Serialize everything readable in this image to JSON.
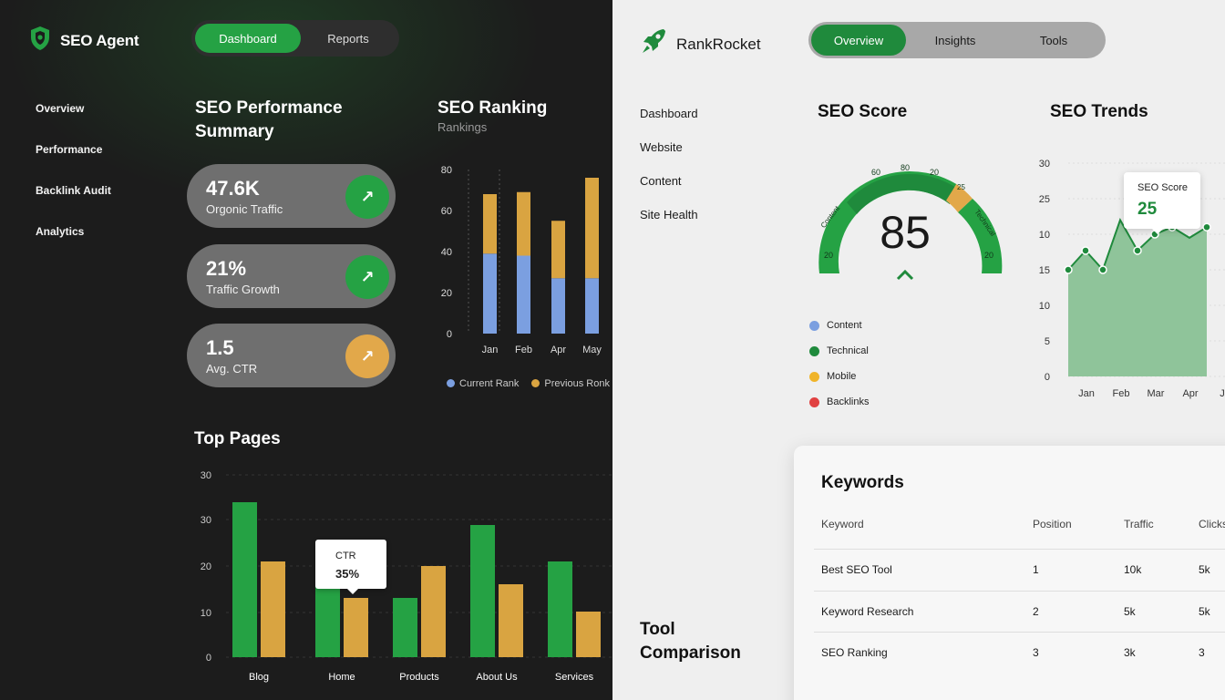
{
  "left": {
    "brand": "SEO Agent",
    "tabs": [
      "Dashboard",
      "Reports"
    ],
    "nav": [
      "Overview",
      "Performance",
      "Backlink Audit",
      "Analytics"
    ],
    "summary_title": "SEO Performance Summary",
    "kpis": [
      {
        "value": "47.6K",
        "label": "Orgonic Traffic",
        "color": "#25a244"
      },
      {
        "value": "21%",
        "label": "Traffic Growth",
        "color": "#25a244"
      },
      {
        "value": "1.5",
        "label": "Avg. CTR",
        "color": "#e2a84a"
      }
    ],
    "ranking_title": "SEO Ranking",
    "ranking_subtitle": "Rankings",
    "ranking_legend": [
      "Current Rank",
      "Previous Ronk"
    ],
    "top_pages_title": "Top Pages",
    "tooltip": {
      "label": "CTR",
      "value": "35%"
    }
  },
  "right": {
    "brand": "RankRocket",
    "tabs": [
      "Overview",
      "Insights",
      "Tools"
    ],
    "nav": [
      "Dashboard",
      "Website",
      "Content",
      "Site Health"
    ],
    "score_title": "SEO Score",
    "score_value": "85",
    "gauge_labels": [
      "20",
      "Content",
      "60",
      "80",
      "20",
      "25",
      "Technical",
      "20"
    ],
    "legend": [
      {
        "label": "Content",
        "color": "#7b9fe0"
      },
      {
        "label": "Technical",
        "color": "#1f8a3c"
      },
      {
        "label": "Mobile",
        "color": "#f0b429"
      },
      {
        "label": "Backlinks",
        "color": "#e04040"
      }
    ],
    "trends_title": "SEO Trends",
    "trend_tooltip": {
      "label": "SEO Score",
      "value": "25"
    },
    "tool_title": "Tool Comparison",
    "keywords": {
      "title": "Keywords",
      "headers": [
        "Keyword",
        "Position",
        "Traffic",
        "Clicks"
      ],
      "rows": [
        [
          "Best SEO Tool",
          "1",
          "10k",
          "5k"
        ],
        [
          "Keyword Research",
          "2",
          "5k",
          "5k"
        ],
        [
          "SEO Ranking",
          "3",
          "3k",
          "3"
        ]
      ]
    }
  },
  "chart_data": [
    {
      "type": "bar",
      "title": "SEO Ranking",
      "subtitle": "Rankings",
      "stacked": true,
      "categories": [
        "Jan",
        "Feb",
        "Apr",
        "May"
      ],
      "series": [
        {
          "name": "Current Rank",
          "values": [
            39,
            38,
            27,
            27
          ],
          "color": "#7b9fe0"
        },
        {
          "name": "Previous Ronk",
          "values": [
            29,
            31,
            28,
            49
          ],
          "color": "#d9a441"
        }
      ],
      "yticks": [
        0,
        20,
        40,
        60,
        80
      ],
      "ylim": [
        0,
        80
      ]
    },
    {
      "type": "bar",
      "title": "Top Pages",
      "categories": [
        "Blog",
        "Home",
        "Products",
        "About Us",
        "Services"
      ],
      "series": [
        {
          "values": [
            34,
            25,
            13,
            29,
            21
          ],
          "color": "#25a244"
        },
        {
          "values": [
            21,
            13,
            20,
            16,
            10
          ],
          "color": "#d9a441"
        }
      ],
      "yticks": [
        "0",
        "10",
        "20",
        "30",
        "30"
      ],
      "ylim": [
        0,
        40
      ]
    },
    {
      "type": "area",
      "title": "SEO Trends",
      "categories": [
        "Jan",
        "Feb",
        "Mar",
        "Apr",
        "Ju"
      ],
      "x": [
        0,
        0.5,
        1,
        1.5,
        2,
        2.5,
        3,
        3.5,
        4
      ],
      "values": [
        15,
        17.7,
        15,
        22,
        17.7,
        20,
        21,
        19.5,
        21
      ],
      "yticks": [
        "0",
        "5",
        "10",
        "15",
        "10",
        "25",
        "30"
      ],
      "ylim": [
        0,
        30
      ],
      "color": "#1f8a3c"
    }
  ]
}
